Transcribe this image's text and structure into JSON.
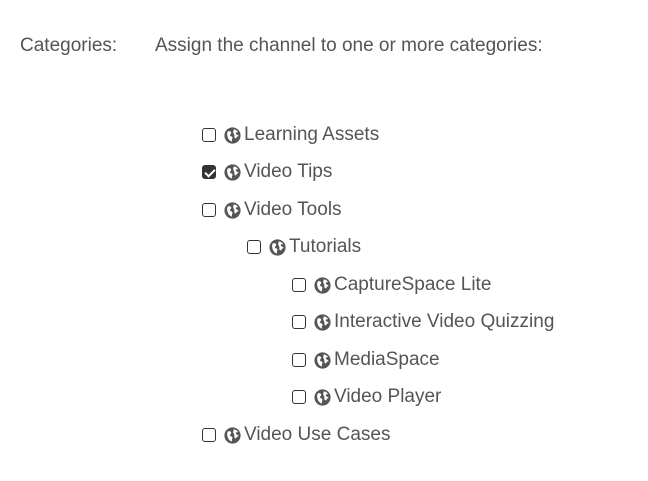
{
  "form": {
    "label": "Categories:",
    "instructions": "Assign the channel to one or more categories:"
  },
  "categories": [
    {
      "label": "Learning Assets",
      "checked": false,
      "icon": "globe-icon"
    },
    {
      "label": "Video Tips",
      "checked": true,
      "icon": "globe-icon"
    },
    {
      "label": "Video Tools",
      "checked": false,
      "icon": "globe-icon"
    },
    {
      "label": "Tutorials",
      "checked": false,
      "icon": "globe-icon"
    },
    {
      "label": "CaptureSpace Lite",
      "checked": false,
      "icon": "globe-icon"
    },
    {
      "label": "Interactive Video Quizzing",
      "checked": false,
      "icon": "globe-icon"
    },
    {
      "label": "MediaSpace",
      "checked": false,
      "icon": "globe-icon"
    },
    {
      "label": "Video Player",
      "checked": false,
      "icon": "globe-icon"
    },
    {
      "label": "Video Use Cases",
      "checked": false,
      "icon": "globe-icon"
    }
  ]
}
